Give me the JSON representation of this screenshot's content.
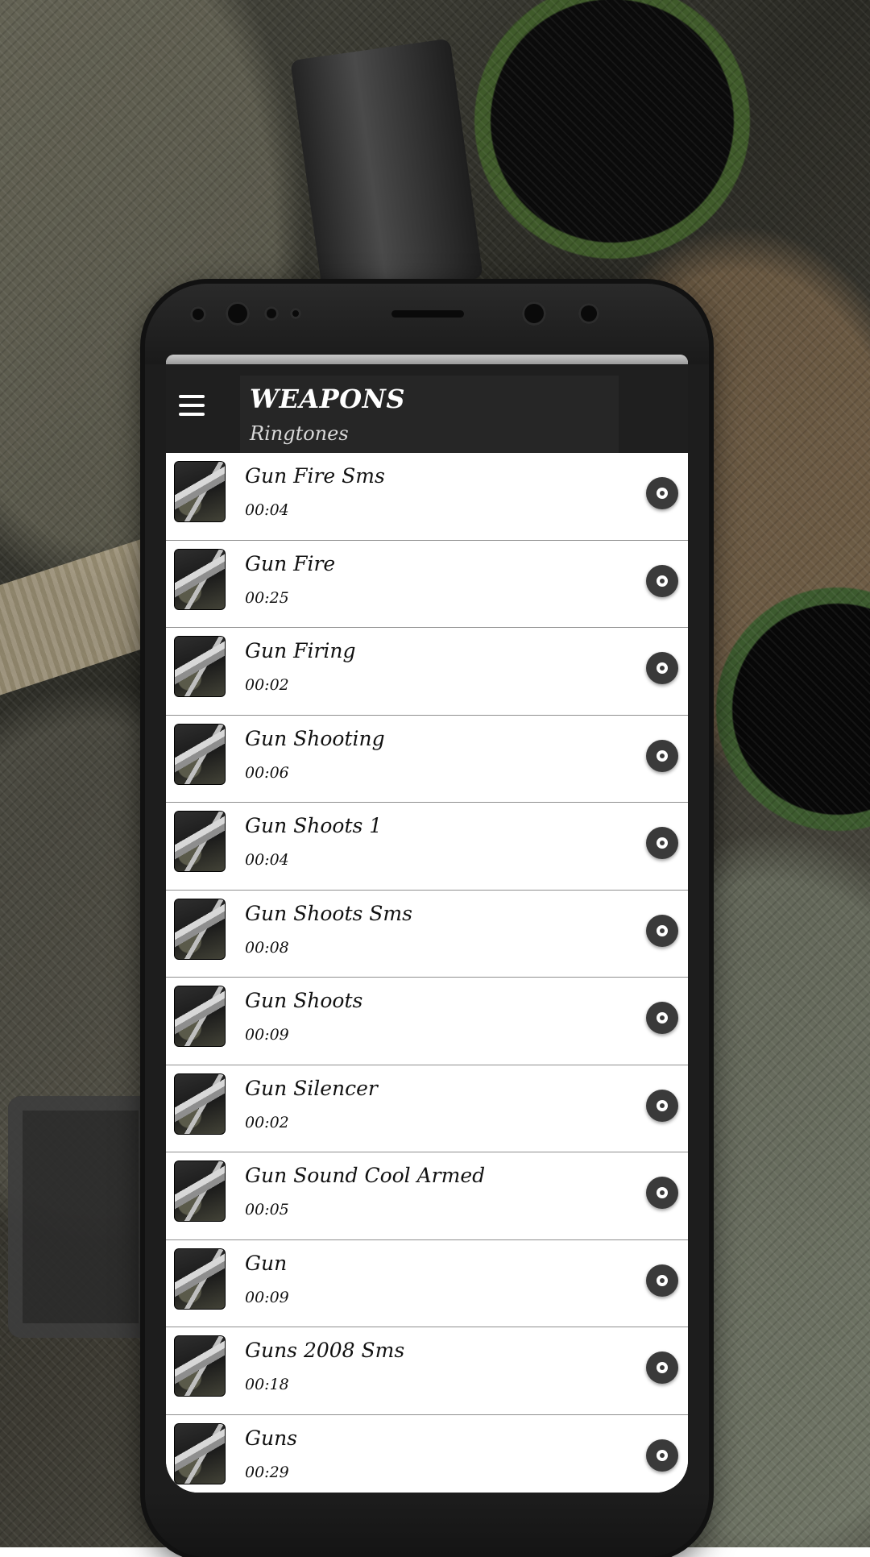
{
  "app": {
    "title": "WEAPONS",
    "subtitle": "Ringtones"
  },
  "menu": {
    "icon": "hamburger-menu-icon"
  },
  "ringtones": [
    {
      "title": "Gun Fire Sms",
      "duration": "00:04"
    },
    {
      "title": "Gun Fire",
      "duration": "00:25"
    },
    {
      "title": "Gun Firing",
      "duration": "00:02"
    },
    {
      "title": "Gun Shooting",
      "duration": "00:06"
    },
    {
      "title": "Gun Shoots 1",
      "duration": "00:04"
    },
    {
      "title": "Gun Shoots Sms",
      "duration": "00:08"
    },
    {
      "title": "Gun Shoots",
      "duration": "00:09"
    },
    {
      "title": "Gun Silencer",
      "duration": "00:02"
    },
    {
      "title": "Gun Sound Cool Armed",
      "duration": "00:05"
    },
    {
      "title": "Gun",
      "duration": "00:09"
    },
    {
      "title": "Guns 2008 Sms",
      "duration": "00:18"
    },
    {
      "title": "Guns",
      "duration": "00:29"
    }
  ],
  "icons": {
    "play": "play-disc-icon",
    "thumbnail": "pistol-thumbnail-icon"
  },
  "colors": {
    "app_bar": "#1f1f1f",
    "list_background": "#ffffff",
    "divider": "#8f8f8f",
    "play_button": "#3a3a3a"
  }
}
